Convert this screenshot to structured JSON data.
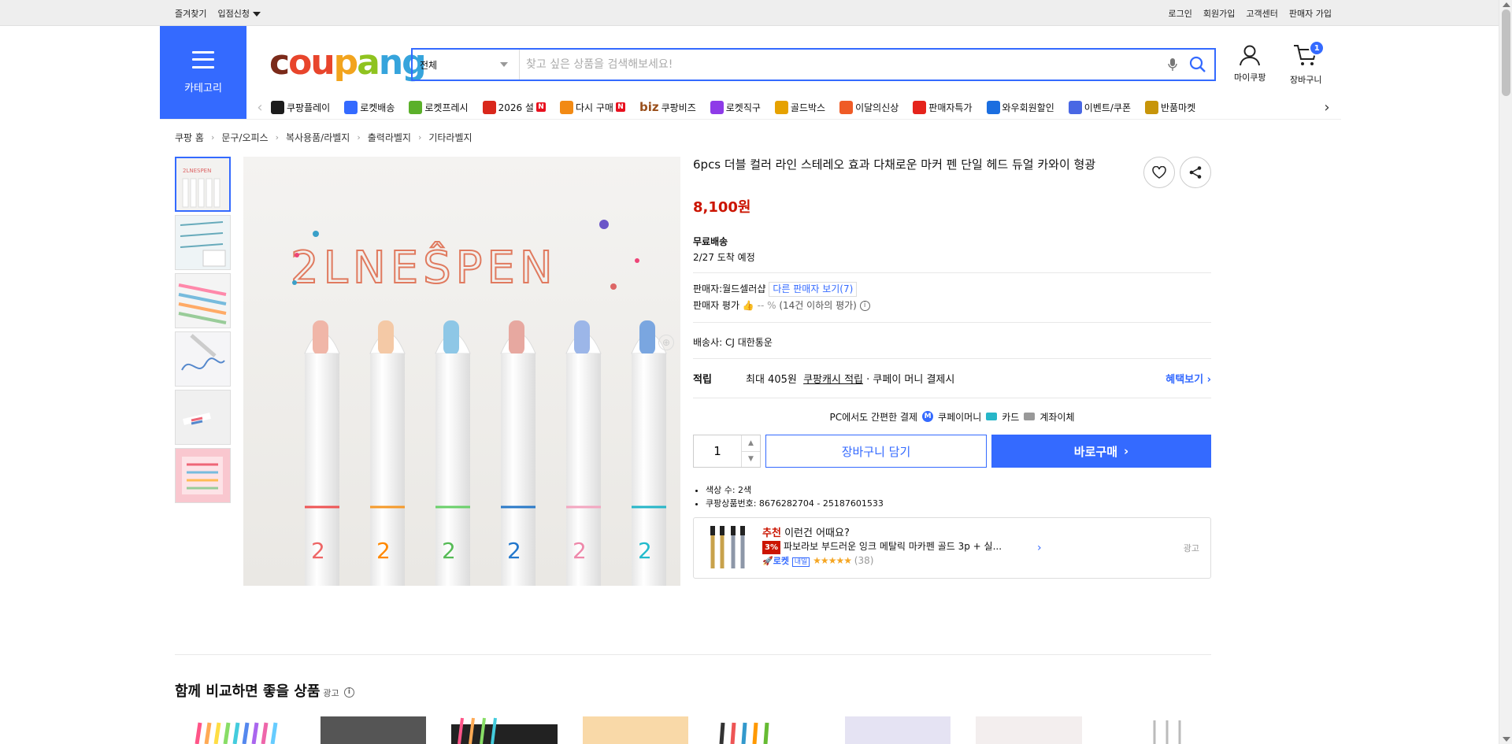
{
  "topbar": {
    "left": [
      "즐겨찾기",
      "입점신청"
    ],
    "right": [
      "로그인",
      "회원가입",
      "고객센터",
      "판매자 가입"
    ]
  },
  "header": {
    "category_label": "카테고리",
    "logo_text": [
      "c",
      "ou",
      "p",
      "a",
      "ng"
    ],
    "search": {
      "category": "전체",
      "placeholder": "찾고 싶은 상품을 검색해보세요!"
    },
    "mycoupang": "마이쿠팡",
    "cart": "장바구니",
    "cart_count": "1"
  },
  "nav": {
    "items": [
      {
        "label": "쿠팡플레이",
        "icon": "play-icon",
        "color": "#1c1c1c"
      },
      {
        "label": "로켓배송",
        "icon": "rocket-icon",
        "color": "#346aff"
      },
      {
        "label": "로켓프레시",
        "icon": "fresh-rocket-icon",
        "color": "#5bb02a"
      },
      {
        "label": "2026 설",
        "icon": "gift-icon",
        "color": "#d9271b",
        "badge": "N"
      },
      {
        "label": "다시 구매",
        "icon": "repurchase-icon",
        "color": "#f28a14",
        "badge": "N"
      },
      {
        "label": "쿠팡비즈",
        "icon": "biz-icon",
        "prefix": "biz"
      },
      {
        "label": "로켓직구",
        "icon": "global-rocket-icon",
        "color": "#8e3be8"
      },
      {
        "label": "골드박스",
        "icon": "goldbox-icon",
        "color": "#e6a200"
      },
      {
        "label": "이달의신상",
        "icon": "new-bag-icon",
        "color": "#ef5b26"
      },
      {
        "label": "판매자특가",
        "icon": "percent-icon",
        "color": "#e5231b"
      },
      {
        "label": "와우회원할인",
        "icon": "wow-icon",
        "color": "#1b6ee0"
      },
      {
        "label": "이벤트/쿠폰",
        "icon": "coupon-icon",
        "color": "#4967e4"
      },
      {
        "label": "반품마켓",
        "icon": "return-market-icon",
        "color": "#c7950a"
      }
    ]
  },
  "breadcrumb": [
    "쿠팡 홈",
    "문구/오피스",
    "복사용품/라벨지",
    "출력라벨지",
    "기타라벨지"
  ],
  "product": {
    "title": "6pcs 더블 컬러 라인 스테레오 효과 다채로운 마커 펜 단일 헤드 듀얼 카와이 형광",
    "image_text": "2LNEŜPEN",
    "price": "8,100원",
    "shipping_label": "무료배송",
    "arrival": "2/27 도착 예정",
    "seller_label": "판매자:",
    "seller_name": "월드셀러샵",
    "seller_more": "다른 판매자 보기(7)",
    "seller_rating_label": "판매자 평가",
    "seller_rating_value": "-- %",
    "seller_rating_count": "(14건 이하의 평가)",
    "carrier_label": "배송사:",
    "carrier_name": "CJ 대한통운",
    "cash_label": "적립",
    "cash_amount": "최대 405원",
    "cash_link": "쿠팡캐시 적립",
    "cash_suffix": "· 쿠페이 머니 결제시",
    "benefit_link": "혜택보기",
    "pay_title": "PC에서도 간편한 결제",
    "pay_methods": [
      "쿠페이머니",
      "카드",
      "계좌이체"
    ],
    "quantity": "1",
    "cart_button": "장바구니 담기",
    "buy_button": "바로구매",
    "specs": [
      "색상 수: 2색",
      "쿠팡상품번호: 8676282704 - 25187601533"
    ]
  },
  "reco": {
    "title_bold": "추천",
    "title": "이런건 어때요?",
    "discount": "3%",
    "name": "파보라보 부드러운 잉크 메탈릭 마카펜 골드 3p + 실...",
    "rocket": "로켓",
    "rocket_tag": "내일",
    "stars": "★★★★★",
    "rating": 4.5,
    "reviews": "(38)",
    "ad": "광고"
  },
  "compare": {
    "title": "함께 비교하면 좋을 상품",
    "ad": "광고"
  },
  "colors": {
    "brand_blue": "#346aff",
    "price_red": "#cb1400"
  }
}
